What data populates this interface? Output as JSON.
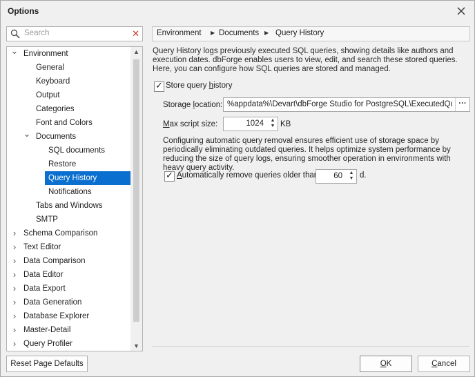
{
  "window": {
    "title": "Options"
  },
  "search": {
    "placeholder": "Search"
  },
  "tree": {
    "items": [
      {
        "label": "Environment",
        "expanded": true
      },
      {
        "label": "General"
      },
      {
        "label": "Keyboard"
      },
      {
        "label": "Output"
      },
      {
        "label": "Categories"
      },
      {
        "label": "Font and Colors"
      },
      {
        "label": "Documents",
        "expanded": true
      },
      {
        "label": "SQL documents"
      },
      {
        "label": "Restore"
      },
      {
        "label": "Query History",
        "selected": true
      },
      {
        "label": "Notifications"
      },
      {
        "label": "Tabs and Windows"
      },
      {
        "label": "SMTP"
      },
      {
        "label": "Schema Comparison",
        "expanded": false
      },
      {
        "label": "Text Editor",
        "expanded": false
      },
      {
        "label": "Data Comparison",
        "expanded": false
      },
      {
        "label": "Data Editor",
        "expanded": false
      },
      {
        "label": "Data Export",
        "expanded": false
      },
      {
        "label": "Data Generation",
        "expanded": false
      },
      {
        "label": "Database Explorer",
        "expanded": false
      },
      {
        "label": "Master-Detail",
        "expanded": false
      },
      {
        "label": "Query Profiler",
        "expanded": false
      }
    ]
  },
  "breadcrumb": [
    "Environment",
    "Documents",
    "Query History"
  ],
  "content": {
    "description": "Query History logs previously executed SQL queries, showing details like authors and execution dates. dbForge enables users to view, edit, and search these stored queries. Here, you can configure how SQL queries are stored and managed.",
    "store_history": {
      "label_pre": "Store query ",
      "label_ul": "h",
      "label_post": "istory",
      "checked": true
    },
    "storage_location": {
      "label_pre": "Storage ",
      "label_ul": "l",
      "label_post": "ocation:",
      "value": "%appdata%\\Devart\\dbForge Studio for PostgreSQL\\ExecutedQueries",
      "browse": "···"
    },
    "max_script_size": {
      "label_ul": "M",
      "label_post": "ax script size:",
      "value": "1024",
      "unit": "KB"
    },
    "auto_remove_desc": "Configuring automatic query removal ensures efficient use of storage space by periodically eliminating outdated queries. It helps optimize system performance by reducing the size of query logs, ensuring smoother operation in environments with heavy query activity.",
    "auto_remove": {
      "label_ul": "A",
      "label_post": "utomatically remove queries older than:",
      "checked": true,
      "value": "60",
      "unit": "d."
    }
  },
  "buttons": {
    "reset": {
      "label": "Reset Page Defaults"
    },
    "ok": {
      "label_ul": "O",
      "label_post": "K"
    },
    "cancel": {
      "label_ul": "C",
      "label_post": "ancel"
    }
  }
}
